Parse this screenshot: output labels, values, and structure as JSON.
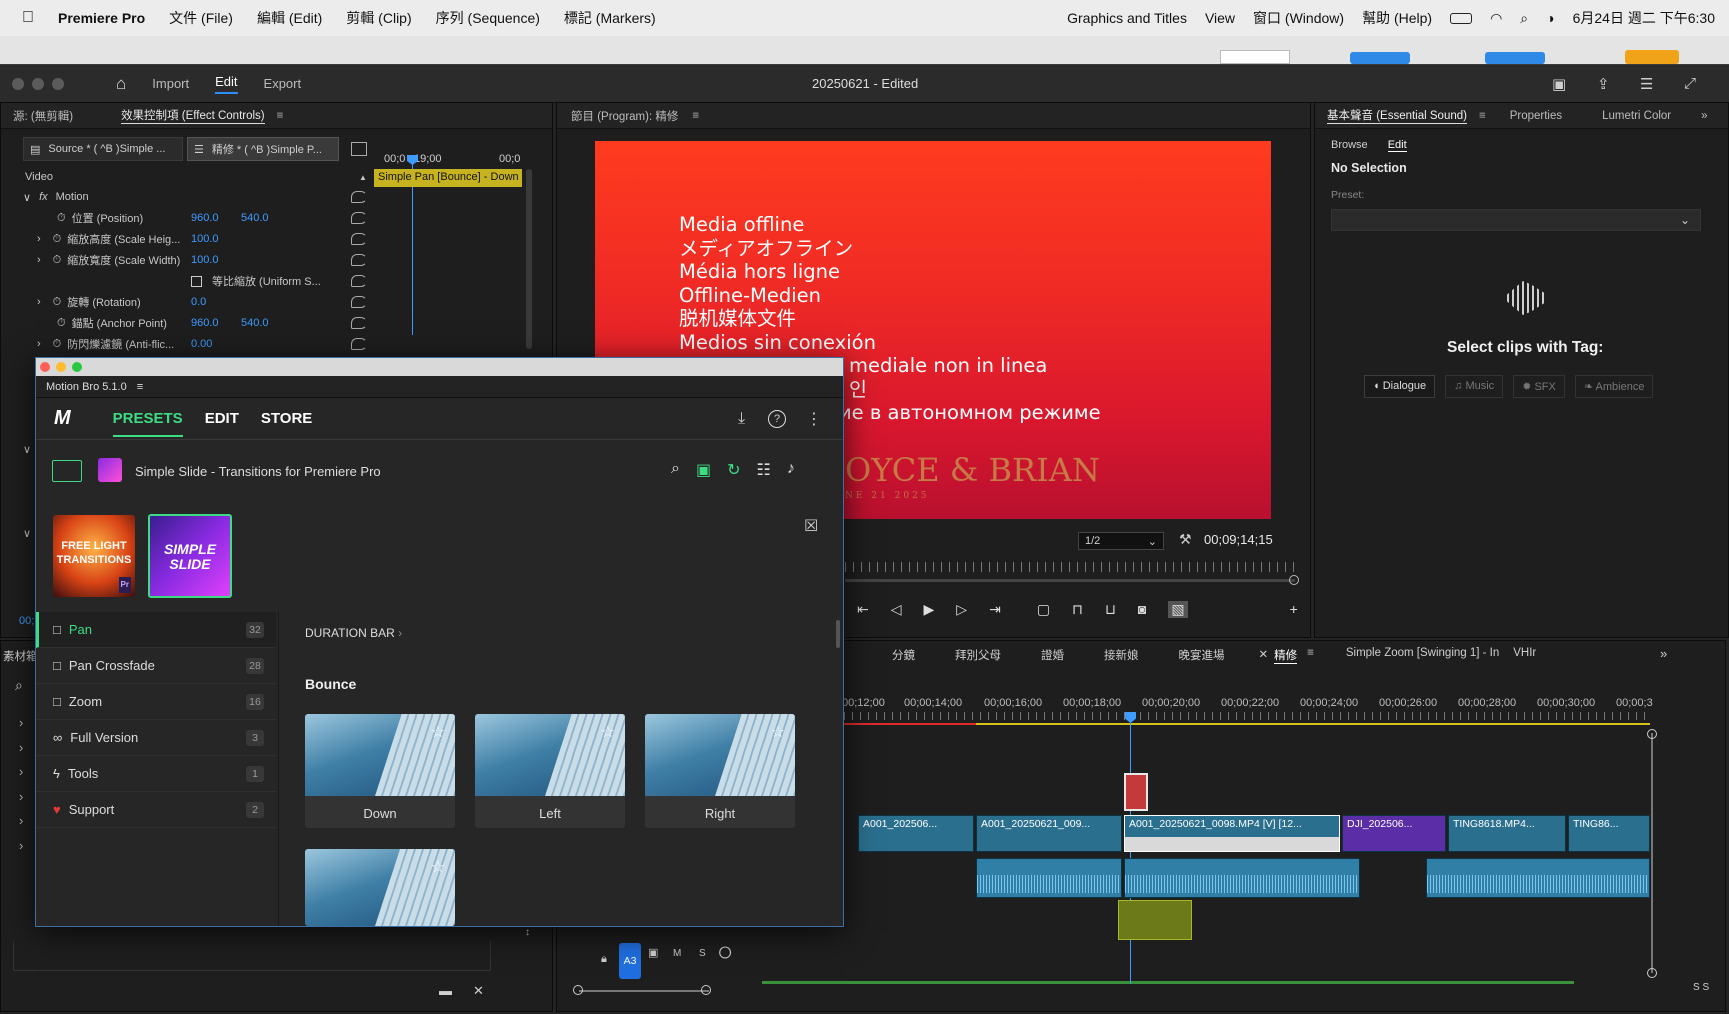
{
  "menubar": {
    "app": "Premiere Pro",
    "items": [
      "文件 (File)",
      "編輯 (Edit)",
      "剪輯 (Clip)",
      "序列 (Sequence)",
      "標記 (Markers)"
    ],
    "right_items": [
      "Graphics and Titles",
      "View",
      "窗口 (Window)",
      "幫助 (Help)"
    ],
    "clock": "6月24日 週二 下午6:30"
  },
  "titlebar": {
    "tabs": [
      "Import",
      "Edit",
      "Export"
    ],
    "active": "Edit",
    "doc_title": "20250621 - Edited"
  },
  "effect_controls": {
    "source_label": "源: (無剪輯)",
    "title": "效果控制項 (Effect Controls)",
    "source_tab": "Source * ( ^B )Simple ...",
    "seq_tab": "精修 * ( ^B )Simple P...",
    "time_left": "00;0",
    "time_mid": "19;00",
    "time_right": "00;0",
    "clip_bar": "Simple Pan [Bounce] - Down",
    "video_label": "Video",
    "fx_label": "fx",
    "motion": "Motion",
    "props": [
      {
        "name": "位置 (Position)",
        "v1": "960.0",
        "v2": "540.0"
      },
      {
        "name": "縮放高度 (Scale Heig...",
        "v1": "100.0",
        "v2": ""
      },
      {
        "name": "縮放寬度 (Scale Width)",
        "v1": "100.0",
        "v2": ""
      },
      {
        "name": "等比縮放 (Uniform S...",
        "v1": "",
        "v2": ""
      },
      {
        "name": "旋轉 (Rotation)",
        "v1": "0.0",
        "v2": ""
      },
      {
        "name": "錨點 (Anchor Point)",
        "v1": "960.0",
        "v2": "540.0"
      },
      {
        "name": "防閃爍濾鏡 (Anti-flic...",
        "v1": "0.00",
        "v2": ""
      }
    ],
    "timecode_left": "00;"
  },
  "project_panel": {
    "label": "素材箱"
  },
  "program": {
    "title": "節目 (Program): 精修",
    "zoom": "1/2",
    "timecode": "00;09;14;15",
    "offline_lines": [
      "Media offline",
      "メディアオフライン",
      "Média hors ligne",
      "Offline-Medien",
      "脱机媒体文件",
      "Medios sin conexión",
      "mediale non in linea",
      "인",
      "ие в автономном режиме"
    ],
    "watermark": "OYCE & BRIAN",
    "watermark_sub": "NE 21 2025"
  },
  "essential_sound": {
    "tabs": [
      "基本聲音 (Essential Sound)",
      "Properties",
      "Lumetri Color"
    ],
    "sub_tabs": [
      "Browse",
      "Edit"
    ],
    "active_sub": "Edit",
    "no_selection": "No Selection",
    "preset_label": "Preset:",
    "select_text": "Select clips with Tag:",
    "tags": [
      "Dialogue",
      "Music",
      "SFX",
      "Ambience"
    ]
  },
  "motion_bro": {
    "title": "Motion Bro 5.1.0",
    "tabs": [
      "PRESETS",
      "EDIT",
      "STORE"
    ],
    "active_tab": "PRESETS",
    "pack_name": "Simple Slide - Transitions for Premiere Pro",
    "packs": [
      {
        "line1": "FREE LIGHT",
        "line2": "TRANSITIONS",
        "badge": "Pr"
      },
      {
        "line1": "SIMPLE",
        "line2": "SLIDE"
      }
    ],
    "categories": [
      {
        "name": "Pan",
        "count": "32",
        "active": true
      },
      {
        "name": "Pan Crossfade",
        "count": "28"
      },
      {
        "name": "Zoom",
        "count": "16"
      },
      {
        "name": "Full Version",
        "count": "3"
      },
      {
        "name": "Tools",
        "count": "1"
      },
      {
        "name": "Support",
        "count": "2"
      }
    ],
    "breadcrumb": "DURATION BAR",
    "section": "Bounce",
    "presets": [
      "Down",
      "Left",
      "Right",
      ""
    ]
  },
  "timeline": {
    "tabs": [
      "分鏡",
      "拜別父母",
      "證婚",
      "接新娘",
      "晚宴進場",
      "精修",
      "Simple Zoom [Swinging 1] - In",
      "VHIr"
    ],
    "active_tab": "精修",
    "ruler": [
      "00;12;00",
      "00;00;14;00",
      "00;00;16;00",
      "00;00;18;00",
      "00;00;20;00",
      "00;00;22;00",
      "00;00;24;00",
      "00;00;26:00",
      "00;00;28;00",
      "00;00;30;00",
      "00;00;3"
    ],
    "video_clips": [
      "A001_202506...",
      "A001_20250621_009...",
      "A001_20250621_0098.MP4 [V] [12...",
      "DJI_202506...",
      "TING8618.MP4...",
      "TING86..."
    ],
    "track": {
      "label": "A3",
      "m": "M",
      "s": "S"
    },
    "vu": "S S"
  },
  "colors": {
    "accent": "#2f8cff",
    "green": "#3ddc84",
    "offline_red": "#ef2a25"
  }
}
